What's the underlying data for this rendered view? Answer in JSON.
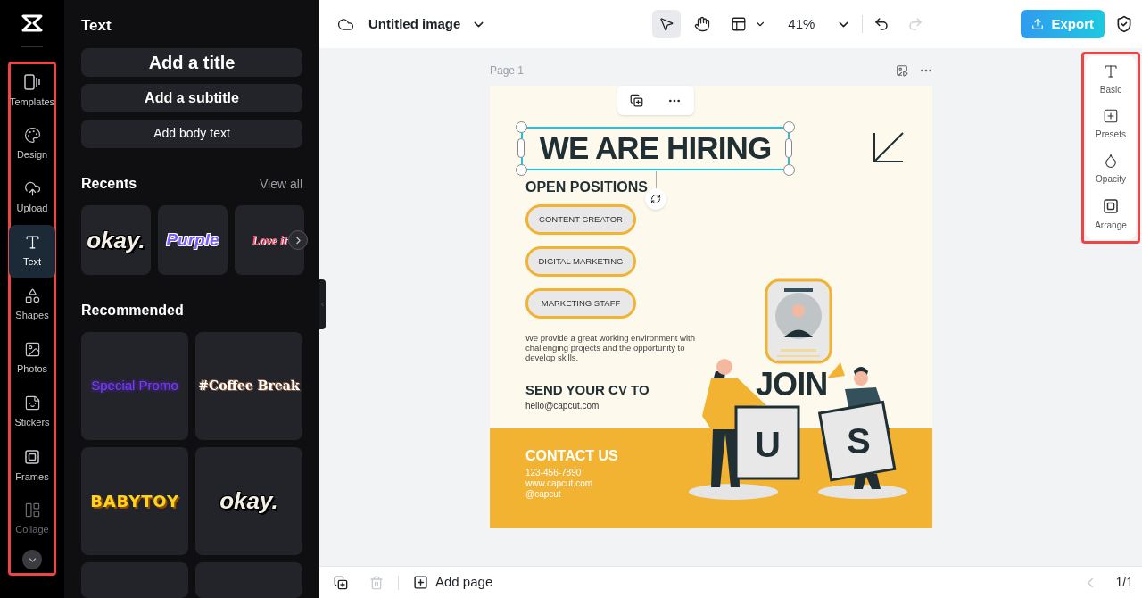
{
  "rail": {
    "items": [
      {
        "label": "Templates",
        "selected": false,
        "dimmed": false
      },
      {
        "label": "Design",
        "selected": false,
        "dimmed": false
      },
      {
        "label": "Upload",
        "selected": false,
        "dimmed": false
      },
      {
        "label": "Text",
        "selected": true,
        "dimmed": false
      },
      {
        "label": "Shapes",
        "selected": false,
        "dimmed": false
      },
      {
        "label": "Photos",
        "selected": false,
        "dimmed": false
      },
      {
        "label": "Stickers",
        "selected": false,
        "dimmed": false
      },
      {
        "label": "Frames",
        "selected": false,
        "dimmed": false
      },
      {
        "label": "Collage",
        "selected": false,
        "dimmed": true
      }
    ]
  },
  "panel": {
    "title": "Text",
    "add_buttons": [
      {
        "label": "Add a title",
        "kind": "title"
      },
      {
        "label": "Add a subtitle",
        "kind": "subtitle"
      },
      {
        "label": "Add body text",
        "kind": "body"
      }
    ],
    "recents": {
      "heading": "Recents",
      "link": "View all",
      "tiles": [
        {
          "text": "okay.",
          "kind": "okay"
        },
        {
          "text": "Purple",
          "kind": "purple"
        },
        {
          "text": "Love it",
          "kind": "love"
        }
      ]
    },
    "recommended": {
      "heading": "Recommended",
      "tiles": [
        {
          "text": "Special Promo",
          "kind": "promo"
        },
        {
          "text": "#Coffee Break",
          "kind": "coffee"
        },
        {
          "text": "BABYTOY",
          "kind": "babytoy"
        },
        {
          "text": "okay.",
          "kind": "okay"
        }
      ]
    }
  },
  "toolbar": {
    "doc_title": "Untitled image",
    "tools": [
      {
        "selected": true
      },
      {
        "selected": false
      }
    ],
    "zoom": "41%",
    "redo_disabled": true,
    "export": "Export"
  },
  "page": {
    "label": "Page 1"
  },
  "poster": {
    "title": "WE ARE HIRING",
    "title_selected": true,
    "positions_heading": "OPEN POSITIONS",
    "positions": [
      "CONTENT CREATOR",
      "DIGITAL MARKETING",
      "MARKETING STAFF"
    ],
    "description": "We provide a great working environment with challenging projects and the opportunity to develop skills.",
    "cv_heading": "SEND YOUR CV TO",
    "email": "hello@capcut.com",
    "contact_heading": "CONTACT US",
    "contacts": [
      "123-456-7890",
      "www.capcut.com",
      "@capcut"
    ],
    "join": "JOIN",
    "letters": [
      "U",
      "S"
    ]
  },
  "properties": [
    {
      "label": "Basic"
    },
    {
      "label": "Presets"
    },
    {
      "label": "Opacity"
    },
    {
      "label": "Arrange"
    }
  ],
  "bottom": {
    "add_page": "Add page",
    "delete_disabled": true,
    "prev_disabled": true,
    "page_counter": "1/1"
  }
}
